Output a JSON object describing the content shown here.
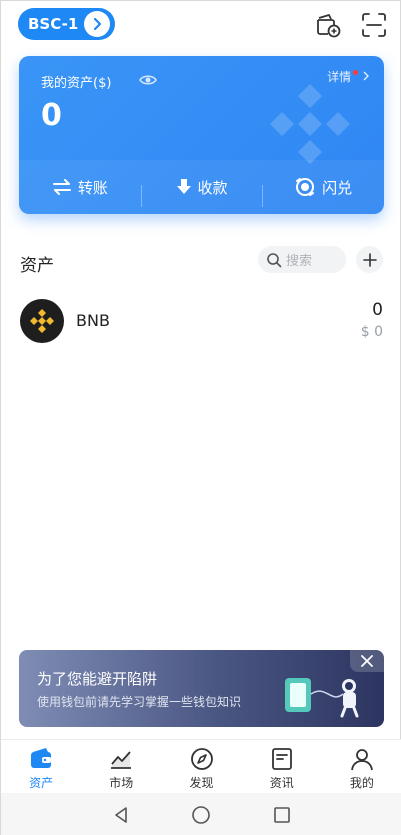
{
  "topbar": {
    "network_label": "BSC-1",
    "icons": [
      "chevron-right-icon",
      "wallet-add-icon",
      "scan-icon"
    ]
  },
  "card": {
    "assets_label": "我的资产($)",
    "detail_label": "详情",
    "balance": "0",
    "actions": [
      {
        "label": "转账",
        "icon": "transfer-icon"
      },
      {
        "label": "收款",
        "icon": "receive-icon"
      },
      {
        "label": "闪兑",
        "icon": "swap-icon"
      }
    ]
  },
  "assets_section": {
    "title": "资产",
    "search_placeholder": "搜索"
  },
  "tokens": [
    {
      "symbol": "BNB",
      "amount": "0",
      "value": "$ 0"
    }
  ],
  "banner": {
    "title": "为了您能避开陷阱",
    "subtitle": "使用钱包前请先学习掌握一些钱包知识"
  },
  "bottom_nav": [
    {
      "label": "资产",
      "icon": "wallet-icon",
      "active": true
    },
    {
      "label": "市场",
      "icon": "market-chart-icon",
      "active": false
    },
    {
      "label": "发现",
      "icon": "compass-icon",
      "active": false
    },
    {
      "label": "资讯",
      "icon": "news-icon",
      "active": false
    },
    {
      "label": "我的",
      "icon": "profile-icon",
      "active": false
    }
  ],
  "colors": {
    "accent": "#1e88f5",
    "card": "#3a95f7",
    "bnb_yellow": "#f3ba2f",
    "notification_dot": "#ff3b30"
  }
}
